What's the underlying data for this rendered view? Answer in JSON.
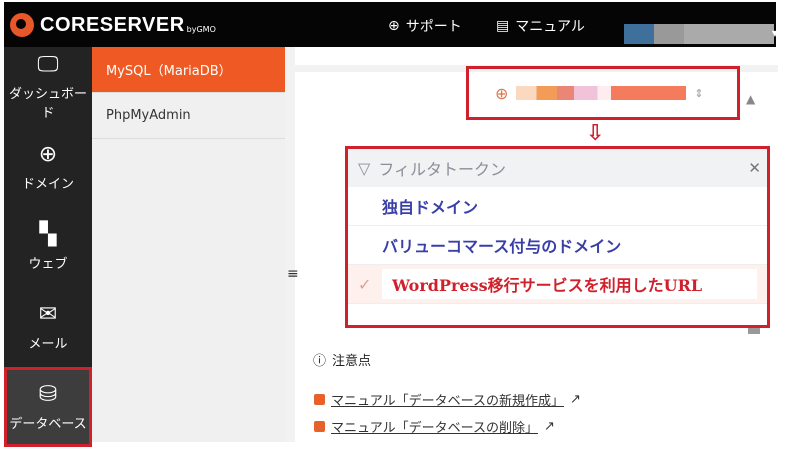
{
  "header": {
    "brand": "CORESERVER",
    "brand_by": "byGMO",
    "support": "サポート",
    "manual": "マニュアル"
  },
  "sidebar": {
    "items": [
      {
        "label": "ダッシュボード",
        "icon": "monitor-icon"
      },
      {
        "label": "ドメイン",
        "icon": "globe-icon"
      },
      {
        "label": "ウェブ",
        "icon": "grid-plus-icon"
      },
      {
        "label": "メール",
        "icon": "envelope-icon"
      },
      {
        "label": "データベース",
        "icon": "database-icon",
        "active": true
      }
    ]
  },
  "submenu": {
    "items": [
      {
        "label": "MySQL（MariaDB）",
        "active": true
      },
      {
        "label": "PhpMyAdmin"
      }
    ]
  },
  "dropdown": {
    "placeholder": "フィルタトークン",
    "options": [
      {
        "label": "独自ドメイン"
      },
      {
        "label": "バリューコマース付与のドメイン"
      },
      {
        "label": "WordPress移行サービスを利用したURL",
        "selected": true
      }
    ]
  },
  "notes": {
    "title": "注意点",
    "links": [
      "マニュアル「データベースの新規作成」",
      "マニュアル「データベースの削除」"
    ]
  },
  "colors": {
    "accent": "#ef5a24",
    "highlight": "#d0202c"
  }
}
